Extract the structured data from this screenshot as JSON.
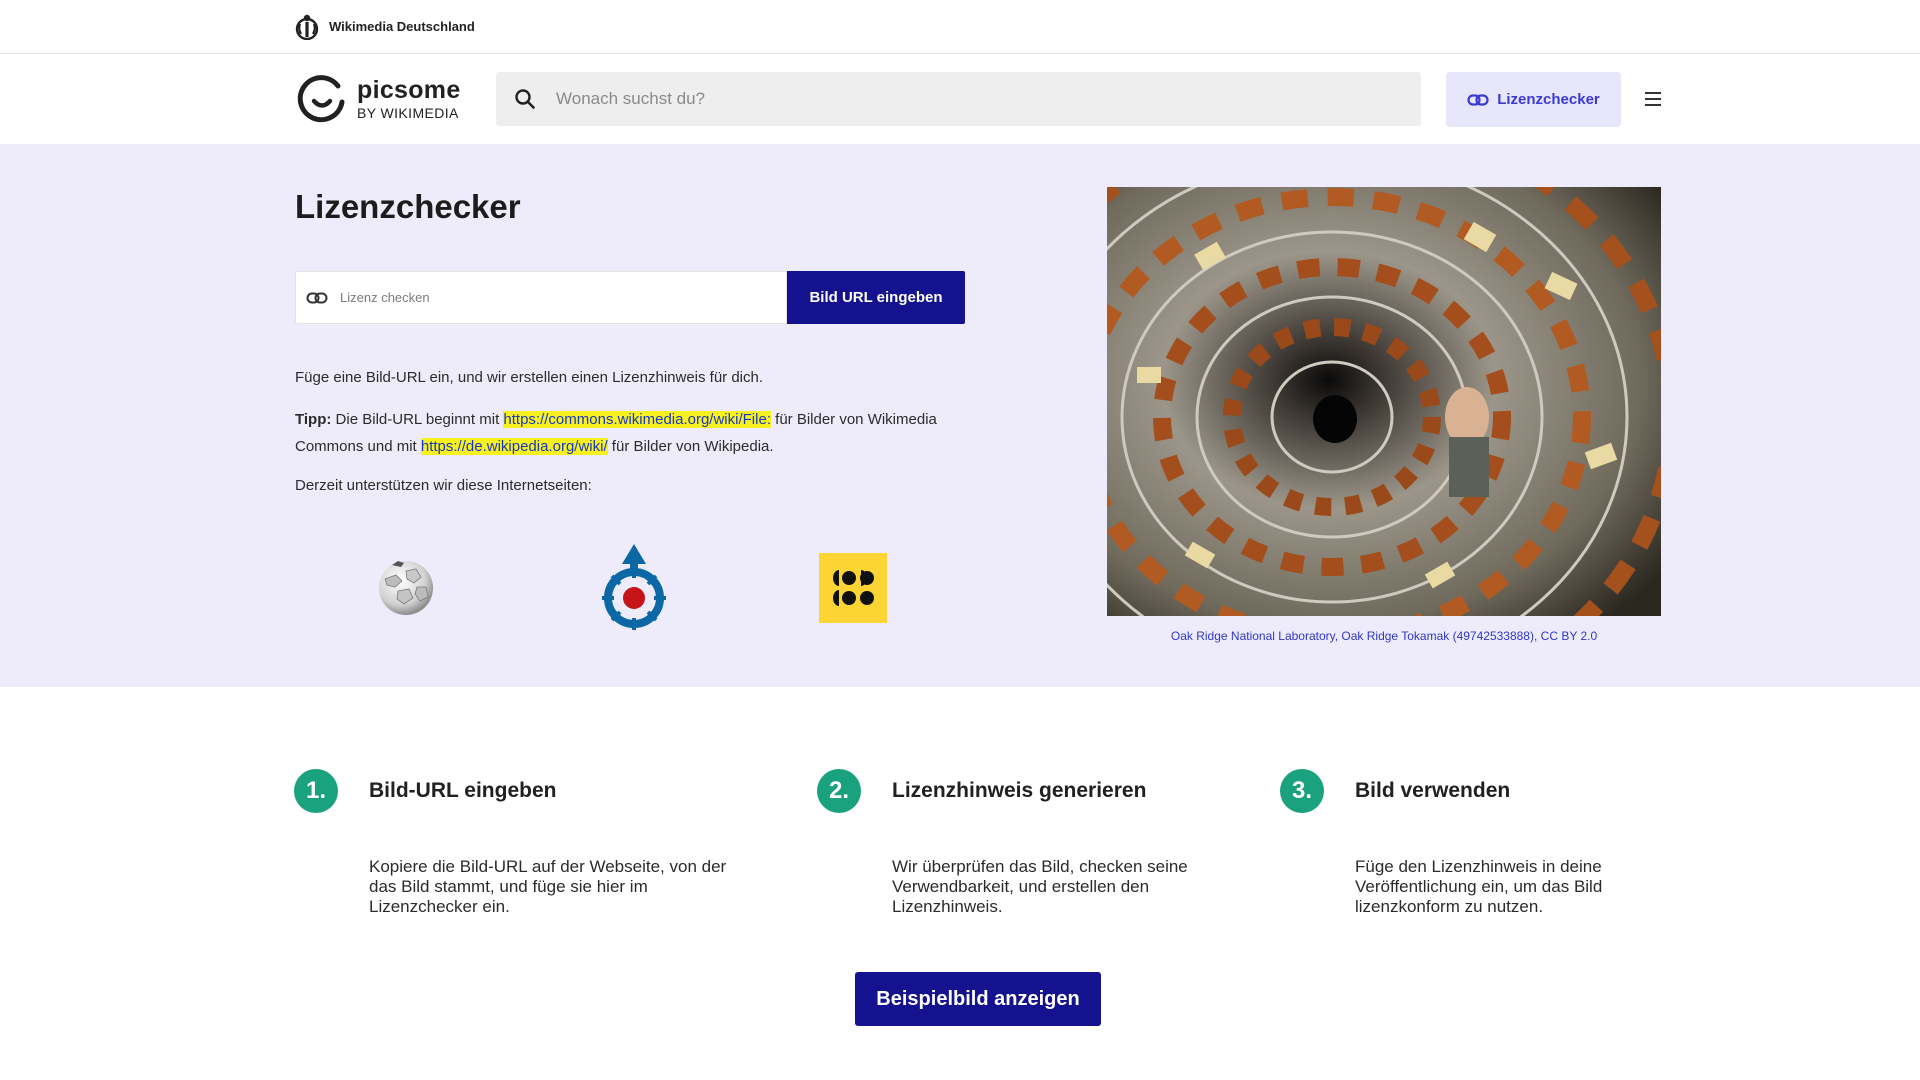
{
  "topbar": {
    "org": "Wikimedia Deutschland"
  },
  "header": {
    "logo_name": "picsome",
    "logo_sub": "BY WIKIMEDIA",
    "search_placeholder": "Wonach suchst du?",
    "license_checker_label": "Lizenzchecker",
    "menu_icon": "hamburger-icon"
  },
  "hero": {
    "title": "Lizenzchecker",
    "input_placeholder": "Lizenz checken",
    "submit_label": "Bild URL eingeben",
    "intro": "Füge eine Bild-URL ein, und wir erstellen einen Lizenzhinweis für dich.",
    "tip_label": "Tipp:",
    "tip_part1": " Die Bild-URL beginnt mit ",
    "tip_url1": "https://commons.wikimedia.org/wiki/File:",
    "tip_part2": " für Bilder von Wikimedia Commons und mit ",
    "tip_url2": "https://de.wikipedia.org/wiki/",
    "tip_part3": " für Bilder von Wikipedia.",
    "supported_intro": "Derzeit unterstützen wir diese Internetseiten:",
    "supported_sites": [
      {
        "icon": "wikipedia-globe-icon"
      },
      {
        "icon": "wikimedia-commons-icon"
      },
      {
        "icon": "yellow-dots-logo-icon"
      }
    ],
    "photo_caption": "Oak Ridge National Laboratory, Oak Ridge Tokamak (49742533888), CC BY 2.0"
  },
  "steps": [
    {
      "number": "1.",
      "title": "Bild-URL eingeben",
      "text": "Kopiere die Bild-URL auf der Webseite, von der das Bild stammt, und füge sie hier im Lizenzchecker ein."
    },
    {
      "number": "2.",
      "title": "Lizenzhinweis generieren",
      "text": "Wir überprüfen das Bild, checken seine Verwendbarkeit, und erstellen den Lizenzhinweis."
    },
    {
      "number": "3.",
      "title": "Bild verwenden",
      "text": "Füge den Lizenzhinweis in deine Veröffentlichung ein, um das Bild lizenzkonform zu nutzen."
    }
  ],
  "cta_label": "Beispielbild anzeigen",
  "colors": {
    "primary": "#14128f",
    "accent_light": "#e7e6fb",
    "hero_bg": "#eeecfb",
    "step_green": "#1aa27e",
    "highlight": "#f7f21f",
    "link": "#2f37c8"
  }
}
